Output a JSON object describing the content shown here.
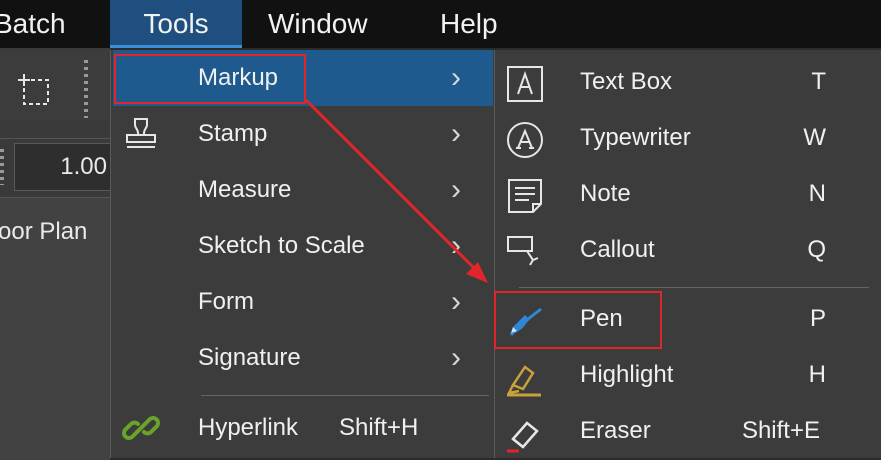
{
  "menubar": {
    "batch": "Batch",
    "tools": "Tools",
    "window": "Window",
    "help": "Help"
  },
  "left_panel": {
    "zoom_value": "1.00",
    "tab_text": "Floor Plan"
  },
  "tools_menu": {
    "items": [
      {
        "label": "Markup",
        "icon": "",
        "shortcut": "",
        "submenu": true
      },
      {
        "label": "Stamp",
        "icon": "stamp-icon",
        "shortcut": "",
        "submenu": true
      },
      {
        "label": "Measure",
        "icon": "",
        "shortcut": "",
        "submenu": true
      },
      {
        "label": "Sketch to Scale",
        "icon": "",
        "shortcut": "",
        "submenu": true
      },
      {
        "label": "Form",
        "icon": "",
        "shortcut": "",
        "submenu": true
      },
      {
        "label": "Signature",
        "icon": "",
        "shortcut": "",
        "submenu": true
      },
      {
        "label": "Hyperlink",
        "icon": "link-icon",
        "shortcut": "Shift+H",
        "submenu": false
      }
    ],
    "arrow_glyph": "›"
  },
  "markup_submenu": {
    "items": [
      {
        "label": "Text Box",
        "key": "T",
        "icon": "text-box-icon"
      },
      {
        "label": "Typewriter",
        "key": "W",
        "icon": "typewriter-icon"
      },
      {
        "label": "Note",
        "key": "N",
        "icon": "note-icon"
      },
      {
        "label": "Callout",
        "key": "Q",
        "icon": "callout-icon"
      },
      {
        "label": "Pen",
        "key": "P",
        "icon": "pen-icon"
      },
      {
        "label": "Highlight",
        "key": "H",
        "icon": "highlight-icon"
      },
      {
        "label": "Eraser",
        "key": "Shift+E",
        "icon": "eraser-icon"
      }
    ]
  },
  "colors": {
    "menubar_bg": "#111111",
    "menu_bg": "#3c3c3c",
    "active_bg": "#1f5a8e",
    "annotation_red": "#e0262b",
    "pen_blue": "#2f86d6",
    "highlight_gold": "#c9a13a",
    "link_green": "#6aa329"
  }
}
